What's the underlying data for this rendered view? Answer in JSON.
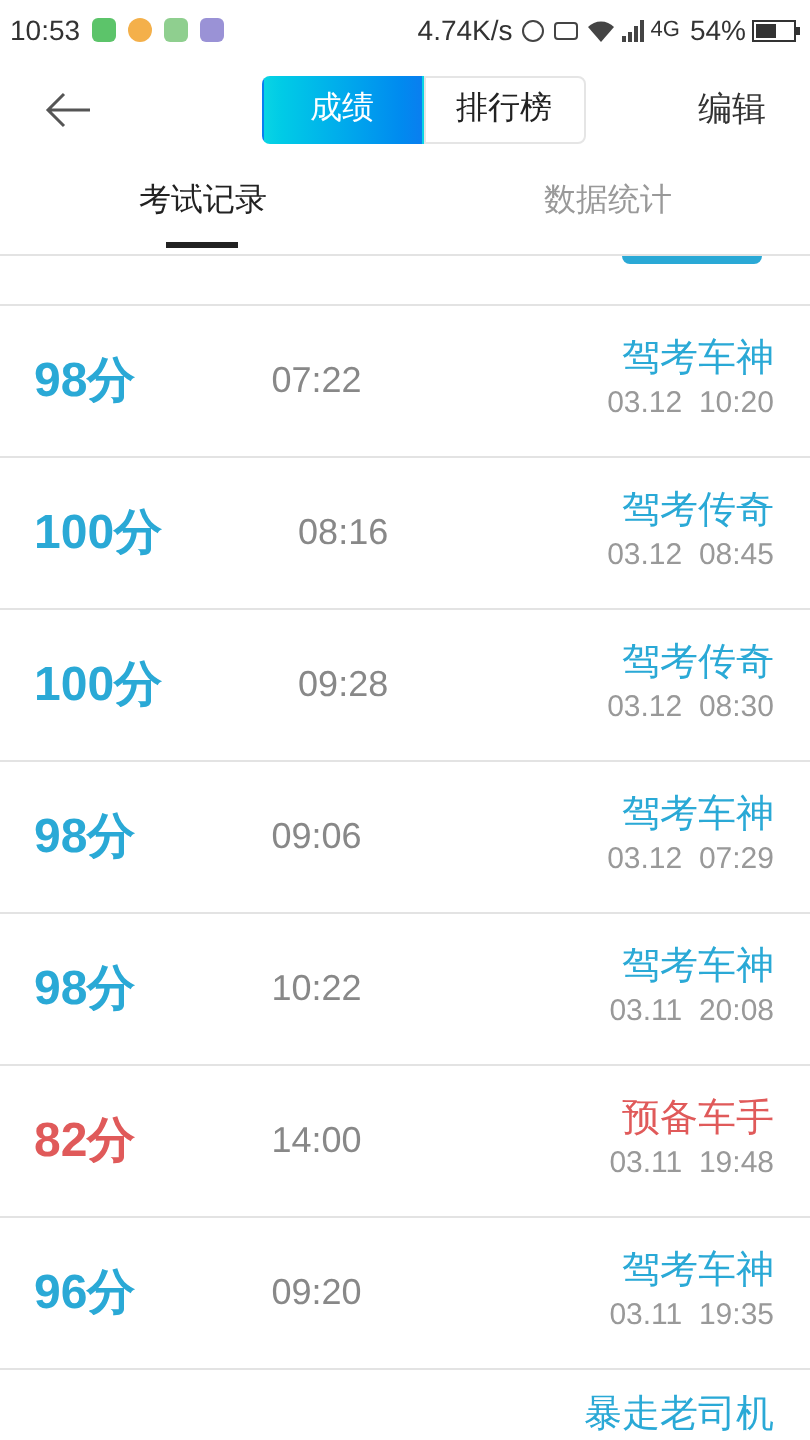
{
  "status_bar": {
    "time": "10:53",
    "speed": "4.74K/s",
    "network": "4G",
    "battery": "54%"
  },
  "nav": {
    "segments": [
      {
        "label": "成绩",
        "selected": true
      },
      {
        "label": "排行榜",
        "selected": false
      }
    ],
    "action": "编辑"
  },
  "tabs": [
    {
      "label": "考试记录",
      "selected": true
    },
    {
      "label": "数据统计",
      "selected": false
    }
  ],
  "records": [
    {
      "score": "98分",
      "duration": "07:22",
      "title": "驾考车神",
      "date": "03.12  10:20",
      "color": "#2aa9d6"
    },
    {
      "score": "100分",
      "duration": "08:16",
      "title": "驾考传奇",
      "date": "03.12  08:45",
      "color": "#2aa9d6"
    },
    {
      "score": "100分",
      "duration": "09:28",
      "title": "驾考传奇",
      "date": "03.12  08:30",
      "color": "#2aa9d6"
    },
    {
      "score": "98分",
      "duration": "09:06",
      "title": "驾考车神",
      "date": "03.12  07:29",
      "color": "#2aa9d6"
    },
    {
      "score": "98分",
      "duration": "10:22",
      "title": "驾考车神",
      "date": "03.11  20:08",
      "color": "#2aa9d6"
    },
    {
      "score": "82分",
      "duration": "14:00",
      "title": "预备车手",
      "date": "03.11  19:48",
      "color": "#e05a5a"
    },
    {
      "score": "96分",
      "duration": "09:20",
      "title": "驾考车神",
      "date": "03.11  19:35",
      "color": "#2aa9d6"
    },
    {
      "title": "暴走老司机",
      "color": "#2aa9d6"
    }
  ]
}
